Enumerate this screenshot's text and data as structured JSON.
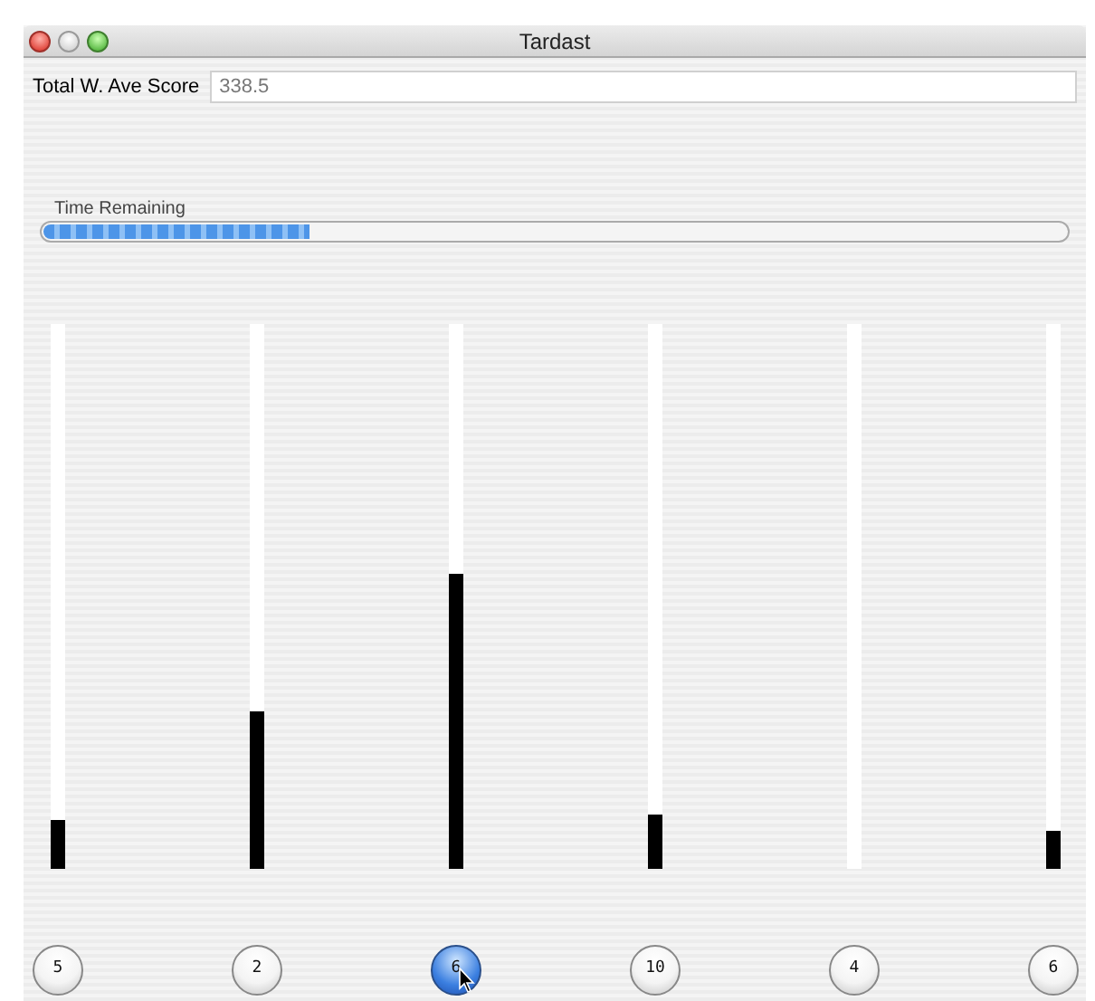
{
  "window": {
    "title": "Tardast"
  },
  "score": {
    "label": "Total W. Ave Score",
    "value": "338.5"
  },
  "timer": {
    "label": "Time Remaining",
    "level": 0.26
  },
  "columns": [
    {
      "level": 0.09,
      "label": "5",
      "selected": false
    },
    {
      "level": 0.29,
      "label": "2",
      "selected": false
    },
    {
      "level": 0.54,
      "label": "6",
      "selected": true
    },
    {
      "level": 0.1,
      "label": "10",
      "selected": false
    },
    {
      "level": 0,
      "label": "4",
      "selected": false
    },
    {
      "level": 0.07,
      "label": "6",
      "selected": false
    }
  ]
}
